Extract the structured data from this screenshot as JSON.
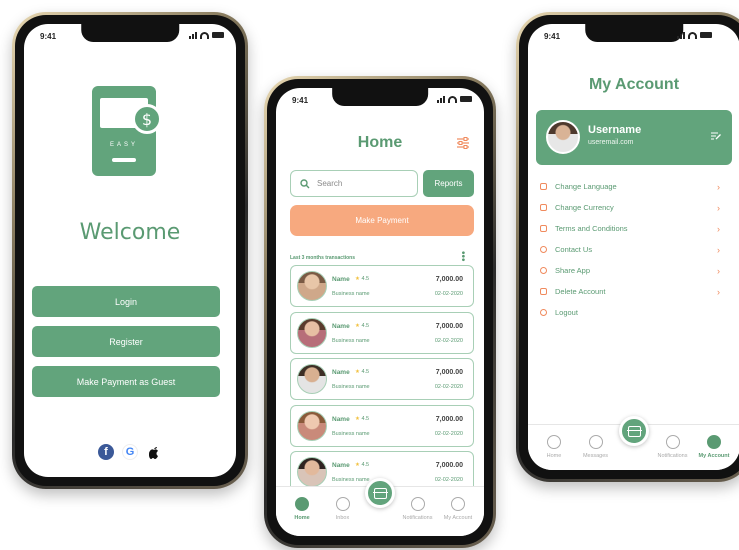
{
  "status_time": "9:41",
  "phone1": {
    "logo_text": "EASY",
    "welcome": "Welcome",
    "login": "Login",
    "register": "Register",
    "guest": "Make Payment as Guest",
    "social": [
      "facebook-icon",
      "google-icon",
      "apple-icon"
    ]
  },
  "phone2": {
    "title": "Home",
    "search_placeholder": "Search",
    "reports": "Reports",
    "make_payment": "Make Payment",
    "txn_title": "Last 3 months transactions",
    "transactions": [
      {
        "name": "Name",
        "rating": "4.5",
        "business": "Business name",
        "amount": "7,000.00",
        "date": "02-02-2020"
      },
      {
        "name": "Name",
        "rating": "4.5",
        "business": "Business name",
        "amount": "7,000.00",
        "date": "02-02-2020"
      },
      {
        "name": "Name",
        "rating": "4.5",
        "business": "Business name",
        "amount": "7,000.00",
        "date": "02-02-2020"
      },
      {
        "name": "Name",
        "rating": "4.5",
        "business": "Business name",
        "amount": "7,000.00",
        "date": "02-02-2020"
      },
      {
        "name": "Name",
        "rating": "4.5",
        "business": "Business name",
        "amount": "7,000.00",
        "date": "02-02-2020"
      }
    ],
    "tabs": {
      "home": "Home",
      "inbox": "Inbox",
      "notifications": "Notifications",
      "account": "My Account"
    }
  },
  "phone3": {
    "title": "My Account",
    "username": "Username",
    "email": "useremail.com",
    "menu": [
      "Change Language",
      "Change Currency",
      "Terms and Conditions",
      "Contact Us",
      "Share App",
      "Delete Account",
      "Logout"
    ],
    "tabs": {
      "home": "Home",
      "messages": "Messages",
      "notifications": "Notifications",
      "account": "My Account"
    }
  },
  "colors": {
    "primary": "#62a47c",
    "accent": "#f7a97f",
    "icon_accent": "#f08a5d"
  }
}
